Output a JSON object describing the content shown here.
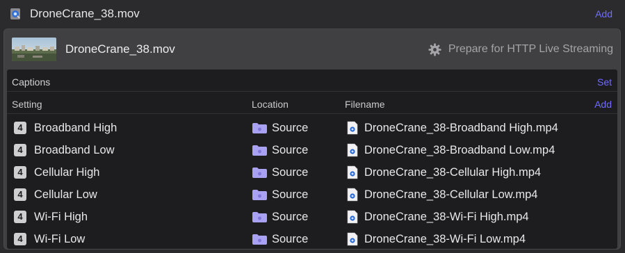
{
  "topbar": {
    "title": "DroneCrane_38.mov",
    "add_label": "Add",
    "icon": "quicktime-file-icon"
  },
  "card": {
    "title": "DroneCrane_38.mov",
    "prepare_label": "Prepare for HTTP Live Streaming",
    "prepare_icon": "gear-icon"
  },
  "captions": {
    "label": "Captions",
    "set_label": "Set"
  },
  "columns": {
    "setting": "Setting",
    "location": "Location",
    "filename": "Filename",
    "add_label": "Add"
  },
  "rows": [
    {
      "badge": "4",
      "setting": "Broadband High",
      "location": "Source",
      "filename": "DroneCrane_38-Broadband High.mp4"
    },
    {
      "badge": "4",
      "setting": "Broadband Low",
      "location": "Source",
      "filename": "DroneCrane_38-Broadband Low.mp4"
    },
    {
      "badge": "4",
      "setting": "Cellular High",
      "location": "Source",
      "filename": "DroneCrane_38-Cellular High.mp4"
    },
    {
      "badge": "4",
      "setting": "Cellular Low",
      "location": "Source",
      "filename": "DroneCrane_38-Cellular Low.mp4"
    },
    {
      "badge": "4",
      "setting": "Wi-Fi High",
      "location": "Source",
      "filename": "DroneCrane_38-Wi-Fi High.mp4"
    },
    {
      "badge": "4",
      "setting": "Wi-Fi Low",
      "location": "Source",
      "filename": "DroneCrane_38-Wi-Fi Low.mp4"
    }
  ],
  "colors": {
    "accent": "#6f6cff",
    "folder": "#a9a2f2",
    "background": "#2a2a2c",
    "panel": "#1d1d1f"
  }
}
